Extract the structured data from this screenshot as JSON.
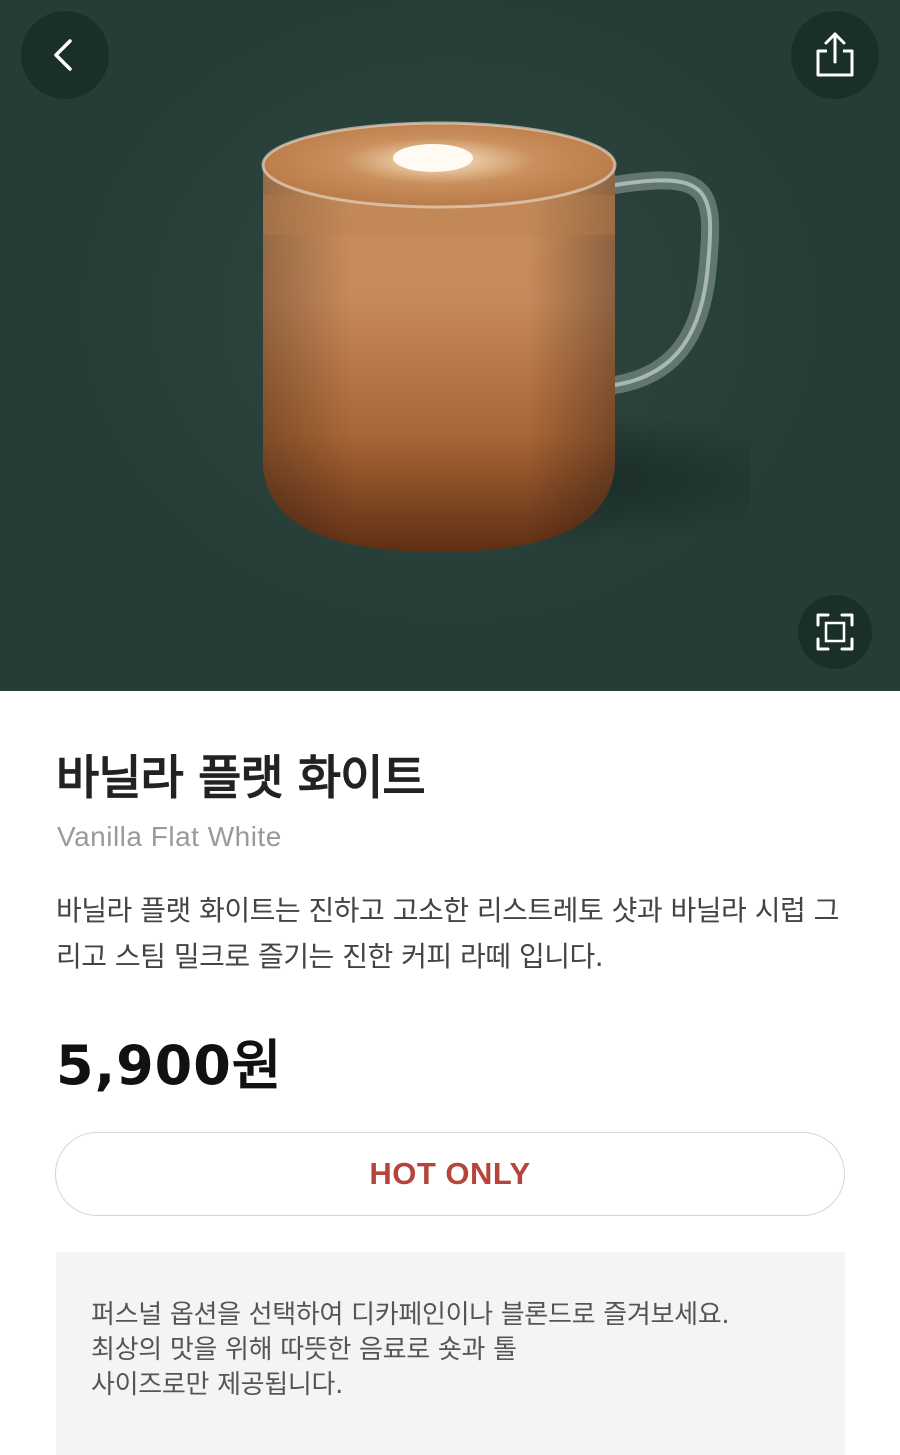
{
  "hero": {
    "background_color": "#263d37",
    "back_icon": "chevron-left-icon",
    "share_icon": "share-icon",
    "zoom_icon": "expand-icon",
    "image_subject": "vanilla flat white in glass mug"
  },
  "product": {
    "name_ko": "바닐라 플랫 화이트",
    "name_en": "Vanilla Flat White",
    "description": "바닐라 플랫 화이트는 진하고 고소한 리스트레토 샷과 바닐라 시럽 그리고 스팀 밀크로 즐기는 진한 커피 라떼 입니다.",
    "price": "5,900원",
    "temperature_option": "HOT ONLY",
    "accent_color": "#b5453a"
  },
  "notice": {
    "lines": [
      "퍼스널 옵션을 선택하여 디카페인이나 블론드로 즐겨보세요.",
      "최상의 맛을 위해 따뜻한 음료로 숏과 톨",
      "사이즈로만 제공됩니다."
    ]
  }
}
